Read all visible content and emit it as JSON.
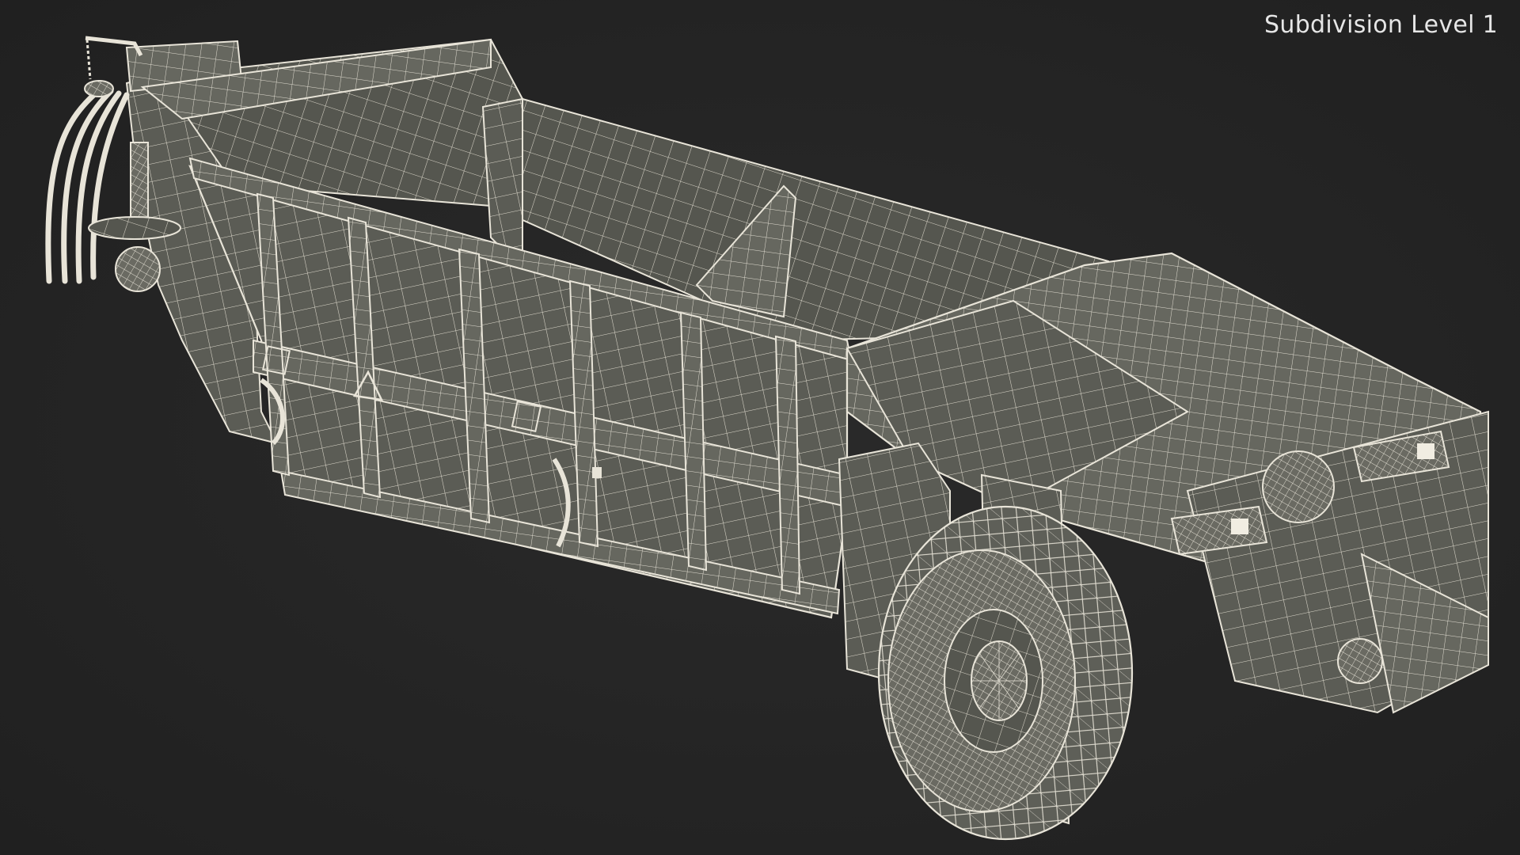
{
  "viewport": {
    "overlay_label": "Subdivision Level 1",
    "background_color": "#252525",
    "model_surface_color": "#5c5d55",
    "wireframe_color": "#e8e4d8",
    "shading": "wireframe-on-shaded"
  }
}
